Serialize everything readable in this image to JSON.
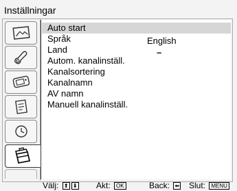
{
  "window": {
    "title": "Inställningar"
  },
  "tabs": [
    {
      "icon": "picture-icon",
      "active": false
    },
    {
      "icon": "sound-icon",
      "active": false
    },
    {
      "icon": "screen-control-icon",
      "active": false
    },
    {
      "icon": "features-icon",
      "active": false
    },
    {
      "icon": "timer-icon",
      "active": false
    },
    {
      "icon": "setup-toolbox-icon",
      "active": true
    },
    {
      "icon": "",
      "active": false
    }
  ],
  "menu": {
    "items": [
      {
        "label": "Auto start",
        "value": "",
        "selected": true
      },
      {
        "label": "Språk",
        "value": "English",
        "selected": false
      },
      {
        "label": "Land",
        "value": "–",
        "selected": false
      },
      {
        "label": "Autom. kanalinställ.",
        "value": "",
        "selected": false
      },
      {
        "label": "Kanalsortering",
        "value": "",
        "selected": false
      },
      {
        "label": "Kanalnamn",
        "value": "",
        "selected": false
      },
      {
        "label": "AV namn",
        "value": "",
        "selected": false
      },
      {
        "label": "Manuell kanalinställ.",
        "value": "",
        "selected": false
      }
    ]
  },
  "footer": {
    "select_label": "Välj:",
    "select_keys": [
      "⬆",
      "⬇"
    ],
    "activate_label": "Akt:",
    "activate_key": "OK",
    "back_label": "Back:",
    "back_key": "⬅",
    "exit_label": "Slut:",
    "exit_key": "MENU"
  }
}
